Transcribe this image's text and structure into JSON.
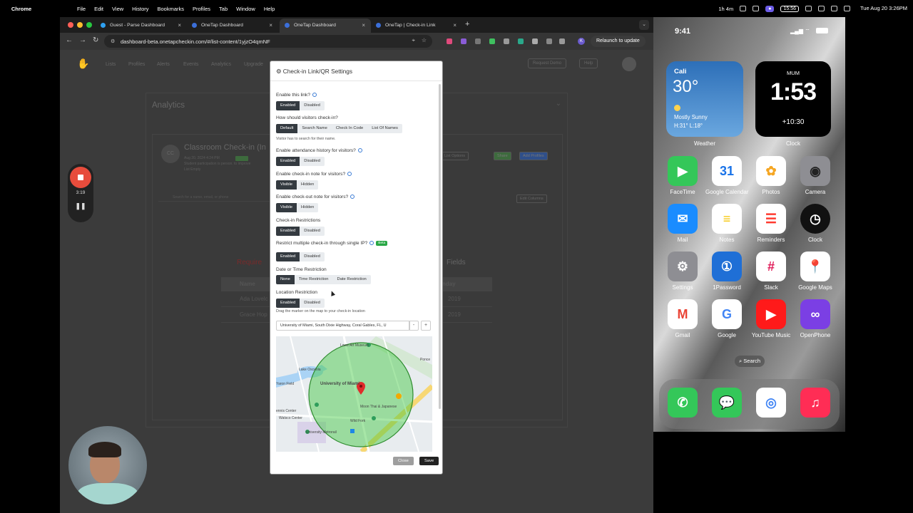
{
  "menubar": {
    "app": "Chrome",
    "items": [
      "File",
      "Edit",
      "View",
      "History",
      "Bookmarks",
      "Profiles",
      "Tab",
      "Window",
      "Help"
    ],
    "timer": "1h 4m",
    "clock_pill": "15:56",
    "datetime": "Tue Aug 20  3:26PM"
  },
  "browser": {
    "tabs": [
      {
        "title": "Guest - Parse Dashboard",
        "fav": "#2ea0f0"
      },
      {
        "title": "OneTap Dashboard",
        "fav": "#3b6fd9"
      },
      {
        "title": "OneTap Dashboard",
        "fav": "#3b6fd9",
        "active": true
      },
      {
        "title": "OneTap | Check-in Link",
        "fav": "#3b6fd9"
      }
    ],
    "url": "dashboard-beta.onetapcheckin.com/#/list-content/1yjzO4qmNF",
    "relaunch": "Relaunch to update",
    "profile_initial": "K"
  },
  "app_nav": {
    "links": [
      "Lists",
      "Profiles",
      "Alerts",
      "Events",
      "Analytics",
      "Upgrade"
    ],
    "request_demo": "Request Demo",
    "help": "Help"
  },
  "background": {
    "card_title": "Analytics",
    "avatar_initials": "CC",
    "list_title": "Classroom Check-in (In",
    "list_date": "Aug 20, 2024 4:24 PM",
    "list_desc": "Student participation is person. to improve",
    "list_empty": "List Empty",
    "buttons": [
      "List Options",
      "Share",
      "Add Profiles"
    ],
    "search_placeholder": "Search for a name, email, or phone",
    "edit_columns": "Edit Columns",
    "required_left": "Require",
    "required_right": "Fields",
    "table": {
      "header": "Name",
      "header_right": "nday",
      "rows": [
        {
          "name": "Ada Lovelc",
          "year": "2019"
        },
        {
          "name": "Grace Hop",
          "year": "2019"
        }
      ]
    }
  },
  "recorder": {
    "time": "3:19",
    "pause": "❚❚"
  },
  "modal": {
    "title": "Check-in Link/QR Settings",
    "fields": [
      {
        "label": "Enable this link?",
        "info": true,
        "options": [
          "Enabled",
          "Disabled"
        ],
        "selected": 0
      },
      {
        "label": "How should visitors check-in?",
        "info": false,
        "options": [
          "Default",
          "Search Name",
          "Check In Code",
          "List Of Names"
        ],
        "selected": 0,
        "hint": "Visitor has to search for their name."
      },
      {
        "label": "Enable attendance history for visitors?",
        "info": true,
        "options": [
          "Enabled",
          "Disabled"
        ],
        "selected": 0
      },
      {
        "label": "Enable check-in note for visitors?",
        "info": true,
        "options": [
          "Visible",
          "Hidden"
        ],
        "selected": 0
      },
      {
        "label": "Enable check-out note for visitors?",
        "info": true,
        "options": [
          "Visible",
          "Hidden"
        ],
        "selected": 0
      },
      {
        "label": "Check-in Restrictions",
        "info": false,
        "options": [
          "Enabled",
          "Disabled"
        ],
        "selected": 0
      },
      {
        "label": "Restrict multiple check-in through single IP?",
        "info": true,
        "badge": "Beta",
        "options": [
          "Enabled",
          "Disabled"
        ],
        "selected": 0
      },
      {
        "label": "Date or Time Restriction",
        "info": false,
        "options": [
          "None",
          "Time Restriction",
          "Date Restriction"
        ],
        "selected": 0
      },
      {
        "label": "Location Restriction",
        "info": false,
        "options": [
          "Enabled",
          "Disabled"
        ],
        "selected": 0,
        "hint": "Drag the marker on the map to your check-in location"
      }
    ],
    "location_value": "University of Miami, South Dixie Highway, Coral Gables, FL, U",
    "minus": "-",
    "plus": "+",
    "map_labels": [
      "Lowe Art Museum",
      "Lake Osceola",
      "University of Miami",
      "Yaron Field",
      "Moon Thai & Japanese",
      "Wild Fork",
      "Watsco Center",
      "ennis Center",
      "University Metrorail",
      "Ponce",
      "Stanford Dr",
      "Ponce de Leon",
      "Leonardo St",
      "Madruga Ave"
    ],
    "close": "Close",
    "save": "Save"
  },
  "phone": {
    "time": "9:41",
    "weather": {
      "city": "Cali",
      "temp": "30°",
      "condition": "Mostly Sunny",
      "hilo": "H:31° L:18°",
      "label": "Weather"
    },
    "clock": {
      "city": "MUM",
      "time": "1:53",
      "offset": "+10:30",
      "label": "Clock"
    },
    "apps": [
      {
        "name": "FaceTime",
        "color": "#34c759",
        "glyph": "▶"
      },
      {
        "name": "Google Calendar",
        "color": "#ffffff",
        "glyph": "31"
      },
      {
        "name": "Photos",
        "color": "#ffffff",
        "glyph": "✿"
      },
      {
        "name": "Camera",
        "color": "#8e8e93",
        "glyph": "◉"
      },
      {
        "name": "Mail",
        "color": "#1a8cff",
        "glyph": "✉"
      },
      {
        "name": "Notes",
        "color": "#ffffff",
        "glyph": "≡"
      },
      {
        "name": "Reminders",
        "color": "#ffffff",
        "glyph": "☰"
      },
      {
        "name": "Clock",
        "color": "#111111",
        "glyph": "◷"
      },
      {
        "name": "Settings",
        "color": "#8e8e93",
        "glyph": "⚙"
      },
      {
        "name": "1Password",
        "color": "#1f6fd6",
        "glyph": "①"
      },
      {
        "name": "Slack",
        "color": "#ffffff",
        "glyph": "#"
      },
      {
        "name": "Google Maps",
        "color": "#ffffff",
        "glyph": "📍"
      },
      {
        "name": "Gmail",
        "color": "#ffffff",
        "glyph": "M"
      },
      {
        "name": "Google",
        "color": "#ffffff",
        "glyph": "G"
      },
      {
        "name": "YouTube Music",
        "color": "#ff1a1a",
        "glyph": "▶"
      },
      {
        "name": "OpenPhone",
        "color": "#7b3fe4",
        "glyph": "∞"
      }
    ],
    "search": "Search",
    "dock": [
      {
        "name": "Phone",
        "color": "#34c759",
        "glyph": "✆"
      },
      {
        "name": "Messages",
        "color": "#34c759",
        "glyph": "💬"
      },
      {
        "name": "Chrome",
        "color": "#ffffff",
        "glyph": "◎"
      },
      {
        "name": "Music",
        "color": "#ff2d55",
        "glyph": "♫"
      }
    ]
  }
}
